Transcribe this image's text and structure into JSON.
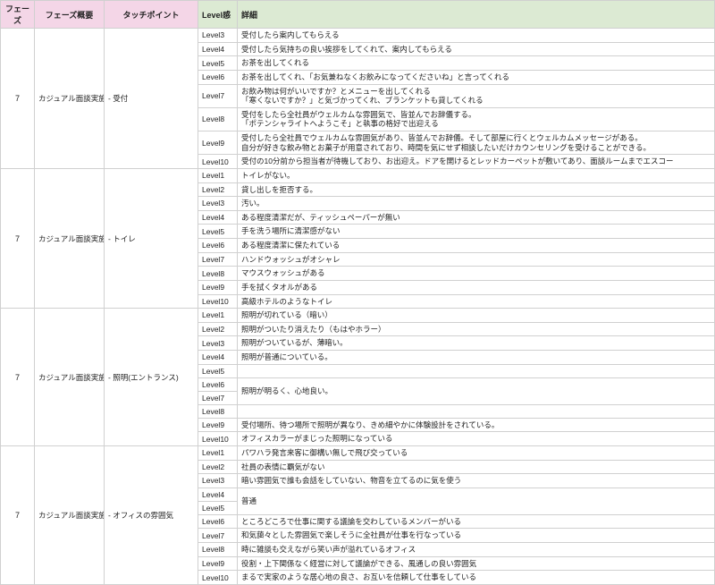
{
  "headers": {
    "phase": "フェーズ",
    "summary": "フェーズ概要",
    "touch": "タッチポイント",
    "level": "Level感",
    "detail": "詳細"
  },
  "groups": [
    {
      "phase": "7",
      "summary": "カジュアル面談実施",
      "touch": "- 受付",
      "rows": [
        {
          "level": "Level3",
          "detail": "受付したら案内してもらえる"
        },
        {
          "level": "Level4",
          "detail": "受付したら気持ちの良い挨拶をしてくれて、案内してもらえる"
        },
        {
          "level": "Level5",
          "detail": "お茶を出してくれる"
        },
        {
          "level": "Level6",
          "detail": "お茶を出してくれ、「お気兼ねなくお飲みになってくださいね」と言ってくれる"
        },
        {
          "level": "Level7",
          "detail": "お飲み物は何がいいですか？とメニューを出してくれる\n「寒くないですか？」と気づかってくれ、ブランケットも貸してくれる"
        },
        {
          "level": "Level8",
          "detail": "受付をしたら全社員がウェルカムな雰囲気で、皆並んでお辞儀する。\n「ポテンシャライトへようこそ」と執事の格好で出迎える"
        },
        {
          "level": "Level9",
          "detail": "受付したら全社員でウェルカムな雰囲気があり、皆並んでお辞儀。そして部屋に行くとウェルカムメッセージがある。\n自分が好きな飲み物とお菓子が用意されており、時間を気にせず相談したいだけカウンセリングを受けることができる。"
        },
        {
          "level": "Level10",
          "detail": "受付の10分前から担当者が待機しており、お出迎え。ドアを開けるとレッドカーペットが敷いてあり、面談ルームまでエスコー"
        }
      ]
    },
    {
      "phase": "7",
      "summary": "カジュアル面談実施",
      "touch": "- トイレ",
      "rows": [
        {
          "level": "Level1",
          "detail": "トイレがない。"
        },
        {
          "level": "Level2",
          "detail": "貸し出しを拒否する。"
        },
        {
          "level": "Level3",
          "detail": "汚い。"
        },
        {
          "level": "Level4",
          "detail": "ある程度清潔だが、ティッシュペーパーが無い"
        },
        {
          "level": "Level5",
          "detail": "手を洗う場所に清潔感がない"
        },
        {
          "level": "Level6",
          "detail": "ある程度清潔に保たれている"
        },
        {
          "level": "Level7",
          "detail": "ハンドウォッシュがオシャレ"
        },
        {
          "level": "Level8",
          "detail": "マウスウォッシュがある"
        },
        {
          "level": "Level9",
          "detail": "手を拭くタオルがある"
        },
        {
          "level": "Level10",
          "detail": "高級ホテルのようなトイレ"
        }
      ]
    },
    {
      "phase": "7",
      "summary": "カジュアル面談実施",
      "touch": "- 照明(エントランス)",
      "rows": [
        {
          "level": "Level1",
          "detail": "照明が切れている（暗い）"
        },
        {
          "level": "Level2",
          "detail": "照明がついたり消えたり（もはやホラー）"
        },
        {
          "level": "Level3",
          "detail": "照明がついているが、薄暗い。"
        },
        {
          "level": "Level4",
          "detail": "照明が普通についている。"
        },
        {
          "level": "Level5",
          "detail": ""
        },
        {
          "level": "Level6",
          "detail": "照明が明るく、心地良い。",
          "merge_with_next": true
        },
        {
          "level": "Level7",
          "detail": ""
        },
        {
          "level": "Level8",
          "detail": ""
        },
        {
          "level": "Level9",
          "detail": "受付場所、待つ場所で照明が異なり、きめ細やかに体験設計をされている。"
        },
        {
          "level": "Level10",
          "detail": "オフィスカラーがまじった照明になっている"
        }
      ]
    },
    {
      "phase": "7",
      "summary": "カジュアル面談実施",
      "touch": "- オフィスの雰囲気",
      "rows": [
        {
          "level": "Level1",
          "detail": "パワハラ発言来客に御構い無しで飛び交っている"
        },
        {
          "level": "Level2",
          "detail": "社員の表情に覇気がない"
        },
        {
          "level": "Level3",
          "detail": "暗い雰囲気で誰も会話をしていない、物音を立てるのに気を使う"
        },
        {
          "level": "Level4",
          "detail": "普通",
          "merge_with_next": true
        },
        {
          "level": "Level5",
          "detail": ""
        },
        {
          "level": "Level6",
          "detail": "ところどころで仕事に関する議論を交わしているメンバーがいる"
        },
        {
          "level": "Level7",
          "detail": "和気藹々とした雰囲気で楽しそうに全社員が仕事を行なっている"
        },
        {
          "level": "Level8",
          "detail": "時に雑談も交えながら笑い声が溢れているオフィス"
        },
        {
          "level": "Level9",
          "detail": "役割・上下関係なく経営に対して議論ができる、風通しの良い雰囲気"
        },
        {
          "level": "Level10",
          "detail": "まるで実家のような居心地の良さ、お互いを信頼して仕事をしている"
        }
      ]
    }
  ]
}
